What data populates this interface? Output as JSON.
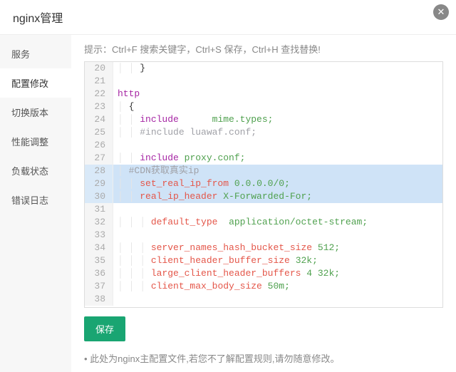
{
  "header": {
    "title": "nginx管理"
  },
  "sidebar": {
    "items": [
      {
        "label": "服务"
      },
      {
        "label": "配置修改"
      },
      {
        "label": "切换版本"
      },
      {
        "label": "性能调整"
      },
      {
        "label": "负载状态"
      },
      {
        "label": "错误日志"
      }
    ],
    "active_index": 1
  },
  "hint": "提示：Ctrl+F 搜索关键字，Ctrl+S 保存，Ctrl+H 查找替换!",
  "highlight_lines": [
    28,
    29,
    30
  ],
  "code_lines": [
    {
      "n": 20,
      "indent": 2,
      "tokens": [
        {
          "t": "}",
          "c": "sym"
        }
      ]
    },
    {
      "n": 21,
      "indent": 0,
      "tokens": []
    },
    {
      "n": 22,
      "indent": 0,
      "tokens": [
        {
          "t": "http",
          "c": "kw"
        }
      ]
    },
    {
      "n": 23,
      "indent": 1,
      "tokens": [
        {
          "t": "{",
          "c": "sym"
        }
      ]
    },
    {
      "n": 24,
      "indent": 2,
      "tokens": [
        {
          "t": "include",
          "c": "kw"
        },
        {
          "t": "      ",
          "c": "sym"
        },
        {
          "t": "mime.types;",
          "c": "str"
        }
      ]
    },
    {
      "n": 25,
      "indent": 2,
      "tokens": [
        {
          "t": "#include luawaf.conf;",
          "c": "cm"
        }
      ]
    },
    {
      "n": 26,
      "indent": 0,
      "tokens": []
    },
    {
      "n": 27,
      "indent": 2,
      "tokens": [
        {
          "t": "include",
          "c": "kw"
        },
        {
          "t": " ",
          "c": "sym"
        },
        {
          "t": "proxy.conf;",
          "c": "str"
        }
      ]
    },
    {
      "n": 28,
      "indent": 1,
      "tokens": [
        {
          "t": "#CDN获取真实ip",
          "c": "cm"
        }
      ]
    },
    {
      "n": 29,
      "indent": 2,
      "tokens": [
        {
          "t": "set_real_ip_from",
          "c": "id"
        },
        {
          "t": " ",
          "c": "sym"
        },
        {
          "t": "0.0.0.0/0;",
          "c": "str"
        }
      ]
    },
    {
      "n": 30,
      "indent": 2,
      "tokens": [
        {
          "t": "real_ip_header",
          "c": "id"
        },
        {
          "t": " ",
          "c": "sym"
        },
        {
          "t": "X-Forwarded-For;",
          "c": "str"
        }
      ]
    },
    {
      "n": 31,
      "indent": 0,
      "tokens": []
    },
    {
      "n": 32,
      "indent": 3,
      "tokens": [
        {
          "t": "default_type",
          "c": "id"
        },
        {
          "t": "  ",
          "c": "sym"
        },
        {
          "t": "application/octet-stream;",
          "c": "str"
        }
      ]
    },
    {
      "n": 33,
      "indent": 0,
      "tokens": []
    },
    {
      "n": 34,
      "indent": 3,
      "tokens": [
        {
          "t": "server_names_hash_bucket_size",
          "c": "id"
        },
        {
          "t": " ",
          "c": "sym"
        },
        {
          "t": "512;",
          "c": "str"
        }
      ]
    },
    {
      "n": 35,
      "indent": 3,
      "tokens": [
        {
          "t": "client_header_buffer_size",
          "c": "id"
        },
        {
          "t": " ",
          "c": "sym"
        },
        {
          "t": "32k;",
          "c": "str"
        }
      ]
    },
    {
      "n": 36,
      "indent": 3,
      "tokens": [
        {
          "t": "large_client_header_buffers",
          "c": "id"
        },
        {
          "t": " ",
          "c": "sym"
        },
        {
          "t": "4 32k;",
          "c": "str"
        }
      ]
    },
    {
      "n": 37,
      "indent": 3,
      "tokens": [
        {
          "t": "client_max_body_size",
          "c": "id"
        },
        {
          "t": " ",
          "c": "sym"
        },
        {
          "t": "50m;",
          "c": "str"
        }
      ]
    },
    {
      "n": 38,
      "indent": 0,
      "tokens": []
    }
  ],
  "actions": {
    "save": "保存"
  },
  "note": "此处为nginx主配置文件,若您不了解配置规则,请勿随意修改。"
}
